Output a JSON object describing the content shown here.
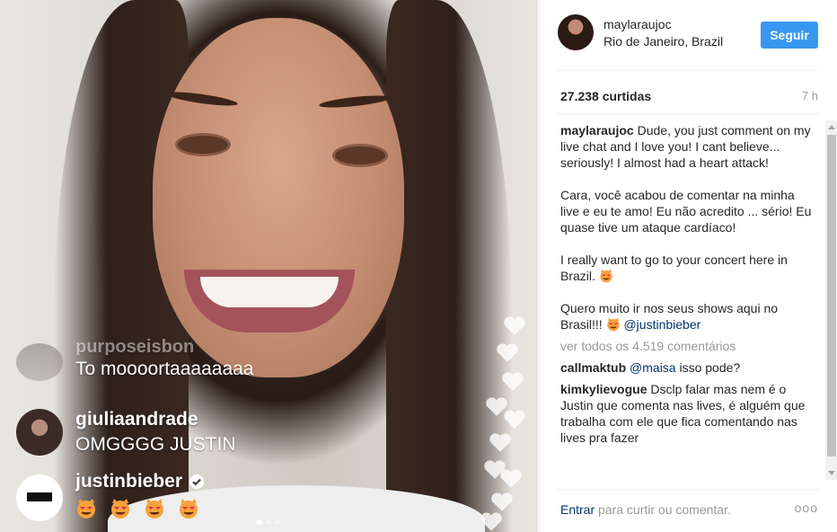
{
  "post": {
    "username": "maylaraujoc",
    "location": "Rio de Janeiro, Brazil",
    "follow_label": "Seguir",
    "likes": "27.238 curtidas",
    "time": "7 h"
  },
  "caption": {
    "username": "maylaraujoc",
    "p1": "Dude, you just comment on my live chat and I love you! I cant believe... seriously! I almost had a heart attack!",
    "p2": "Cara, você acabou de comentar na minha live e eu te amo! Eu não acredito ... sério! Eu quase tive um ataque cardíaco!",
    "p3": "I really want to go to your concert here in Brazil.",
    "p4": "Quero muito ir nos seus shows aqui no Brasil!!!",
    "mention": "@justinbieber"
  },
  "view_all": "ver todos os 4.519 comentários",
  "comments": [
    {
      "user": "callmaktub",
      "mention": "@maisa",
      "text": "isso pode?"
    },
    {
      "user": "kimkylievogue",
      "text": "Dsclp falar mas nem é o Justin que comenta nas lives, é alguém que trabalha com ele que fica comentando nas lives pra fazer"
    }
  ],
  "footer": {
    "login": "Entrar",
    "rest": "para curtir ou comentar.",
    "more": "ooo"
  },
  "live_comments": [
    {
      "user": "purposeisbon",
      "text": "To moooortaaaaaaaa"
    },
    {
      "user": "giuliaandrade",
      "text": "OMGGGG JUSTIN"
    },
    {
      "user": "justinbieber",
      "text": ""
    }
  ],
  "colors": {
    "accent": "#3897f0",
    "mention": "#003569",
    "muted": "#999999"
  },
  "icons": {
    "verified": "verified-badge-icon",
    "emoji": "heart-eyes-cat-emoji",
    "like": "heart-icon"
  }
}
